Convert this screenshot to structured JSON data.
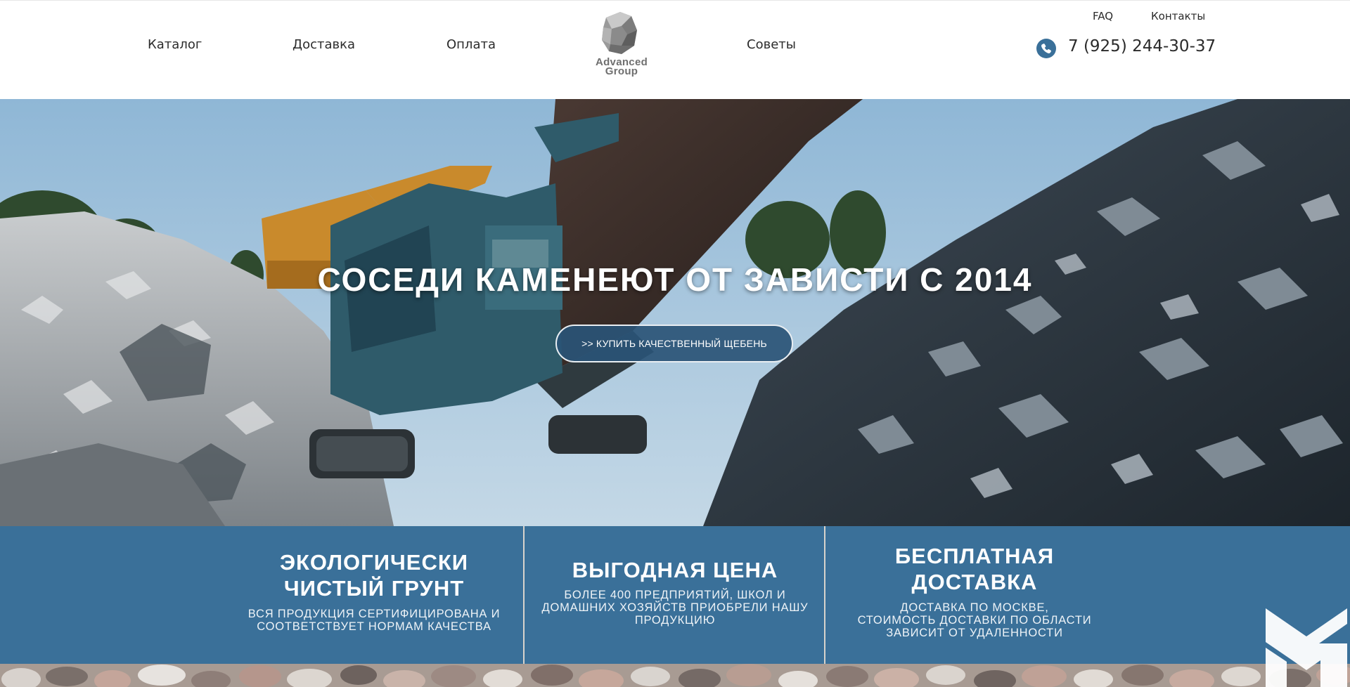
{
  "nav": {
    "catalog": "Каталог",
    "delivery": "Доставка",
    "payment": "Оплата",
    "tips": "Советы"
  },
  "logo": {
    "line1": "Advanced",
    "line2": "Group",
    "icon": "stone-logo-icon"
  },
  "top_links": {
    "faq": "FAQ",
    "contacts": "Контакты"
  },
  "phone": {
    "icon": "phone-icon",
    "number": "7 (925) 244-30-37"
  },
  "hero": {
    "title": "СОСЕДИ КАМЕНЕЮТ ОТ ЗАВИСТИ С 2014",
    "cta": ">> КУПИТЬ КАЧЕСТВЕННЫЙ ЩЕБЕНЬ"
  },
  "features": [
    {
      "title_line1": "ЭКОЛОГИЧЕСКИ",
      "title_line2": "ЧИСТЫЙ ГРУНТ",
      "desc_line1": "ВСЯ ПРОДУКЦИЯ СЕРТИФИЦИРОВАНА И",
      "desc_line2": "СООТВЕТСТВУЕТ НОРМАМ КАЧЕСТВА"
    },
    {
      "title_line1": "ВЫГОДНАЯ ЦЕНА",
      "desc_line1": "БОЛЕЕ 400 ПРЕДПРИЯТИЙ, ШКОЛ И",
      "desc_line2": "ДОМАШНИХ ХОЗЯЙСТВ ПРИОБРЕЛИ НАШУ",
      "desc_line3": "ПРОДУКЦИЮ"
    },
    {
      "title_line1": "БЕСПЛАТНАЯ",
      "title_line2": "ДОСТАВКА",
      "desc_line1": "ДОСТАВКА ПО МОСКВЕ,",
      "desc_line2": "СТОИМОСТЬ ДОСТАВКИ ПО ОБЛАСТИ",
      "desc_line3": "ЗАВИСИТ ОТ УДАЛЕННОСТИ"
    }
  ],
  "colors": {
    "accent": "#3a7099",
    "button_bg": "#2a5476",
    "text": "#2b2b2b"
  },
  "widget": {
    "icon": "brand-widget-icon"
  }
}
